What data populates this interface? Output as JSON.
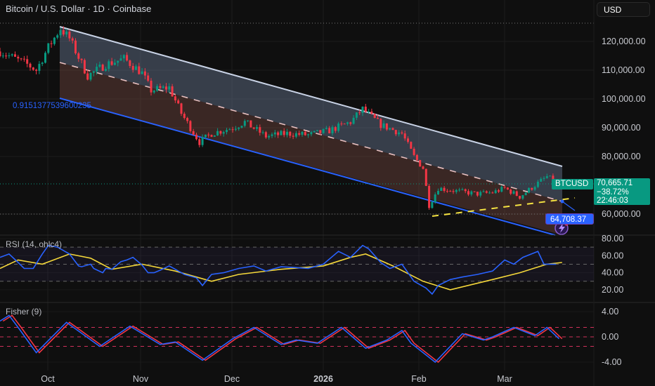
{
  "header": {
    "title": "Bitcoin / U.S. Dollar · 1D · Coinbase",
    "currency_button": "USD"
  },
  "colors": {
    "up": "#089981",
    "down": "#f23645",
    "rsi": "#2962ff",
    "rsi_ma": "#f5d83a",
    "fisher": "#2962ff",
    "fisher_trigger": "#f23645",
    "channel_line": "#c9d3e6",
    "channel_bottom": "#2962ff",
    "median": "#e8c0c0",
    "yellow_line": "#f5e342"
  },
  "price_axis": [
    "120,000.00",
    "110,000.00",
    "100,000.00",
    "90,000.00",
    "80,000.00",
    "60,000.00"
  ],
  "rsi_axis": [
    "80.00",
    "60.00",
    "40.00",
    "20.00"
  ],
  "fisher_axis": [
    "4.00",
    "0.00",
    "-4.00"
  ],
  "time_axis": [
    "Oct",
    "Nov",
    "Dec",
    "2026",
    "Feb",
    "Mar"
  ],
  "symbol_tag": "BTCUSD",
  "last_price": {
    "price": "70,665.71",
    "change": "−38.72%",
    "countdown": "22:46:03"
  },
  "alert_price": "64,708.37",
  "fib_label": "0.9151377539600235",
  "rsi_label": "RSI (14, ohlc4)",
  "fisher_label": "Fisher (9)",
  "chart_data": {
    "type": "candlestick",
    "start_date": "2025-09-15",
    "x_unit": "days since start_date",
    "price_keypoints": [
      [
        0,
        116500
      ],
      [
        9,
        112000
      ],
      [
        12,
        110000
      ],
      [
        16,
        118000
      ],
      [
        20,
        124500
      ],
      [
        23,
        121000
      ],
      [
        29,
        108000
      ],
      [
        35,
        112000
      ],
      [
        41,
        114000
      ],
      [
        47,
        109000
      ],
      [
        50,
        103000
      ],
      [
        56,
        104000
      ],
      [
        60,
        95000
      ],
      [
        66,
        85000
      ],
      [
        70,
        88000
      ],
      [
        77,
        90000
      ],
      [
        81,
        92000
      ],
      [
        88,
        87000
      ],
      [
        95,
        88000
      ],
      [
        102,
        87500
      ],
      [
        109,
        89000
      ],
      [
        116,
        92000
      ],
      [
        120,
        96500
      ],
      [
        126,
        91000
      ],
      [
        133,
        88000
      ],
      [
        137,
        80000
      ],
      [
        140,
        76000
      ],
      [
        142,
        63000
      ],
      [
        145,
        69000
      ],
      [
        151,
        68000
      ],
      [
        158,
        67000
      ],
      [
        163,
        67500
      ],
      [
        167,
        69000
      ],
      [
        172,
        66000
      ],
      [
        177,
        70000
      ],
      [
        181,
        73000
      ],
      [
        184,
        71000
      ],
      [
        185,
        70665
      ]
    ],
    "y_range": [
      56000,
      127000
    ],
    "rsi": {
      "values": [
        [
          0,
          58
        ],
        [
          3,
          62
        ],
        [
          6,
          52
        ],
        [
          8,
          45
        ],
        [
          11,
          45
        ],
        [
          14,
          62
        ],
        [
          16,
          72
        ],
        [
          19,
          70
        ],
        [
          23,
          62
        ],
        [
          26,
          48
        ],
        [
          27,
          47
        ],
        [
          30,
          50
        ],
        [
          31,
          45
        ],
        [
          34,
          40
        ],
        [
          35,
          45
        ],
        [
          37,
          44
        ],
        [
          40,
          53
        ],
        [
          42,
          55
        ],
        [
          44,
          58
        ],
        [
          47,
          49
        ],
        [
          49,
          40
        ],
        [
          51,
          40
        ],
        [
          53,
          43
        ],
        [
          56,
          48
        ],
        [
          58,
          44
        ],
        [
          61,
          38
        ],
        [
          65,
          34
        ],
        [
          67,
          25
        ],
        [
          70,
          38
        ],
        [
          74,
          40
        ],
        [
          79,
          45
        ],
        [
          84,
          48
        ],
        [
          88,
          42
        ],
        [
          93,
          47
        ],
        [
          98,
          46
        ],
        [
          102,
          45
        ],
        [
          107,
          50
        ],
        [
          112,
          65
        ],
        [
          116,
          58
        ],
        [
          120,
          72
        ],
        [
          122,
          68
        ],
        [
          126,
          52
        ],
        [
          129,
          45
        ],
        [
          133,
          50
        ],
        [
          137,
          30
        ],
        [
          141,
          22
        ],
        [
          143,
          15
        ],
        [
          145,
          25
        ],
        [
          149,
          32
        ],
        [
          153,
          35
        ],
        [
          158,
          38
        ],
        [
          163,
          42
        ],
        [
          167,
          55
        ],
        [
          170,
          50
        ],
        [
          173,
          58
        ],
        [
          178,
          65
        ],
        [
          180,
          50
        ],
        [
          184,
          50
        ]
      ],
      "ma": [
        [
          0,
          45
        ],
        [
          6,
          55
        ],
        [
          14,
          50
        ],
        [
          23,
          62
        ],
        [
          30,
          57
        ],
        [
          37,
          44
        ],
        [
          47,
          50
        ],
        [
          58,
          42
        ],
        [
          70,
          30
        ],
        [
          79,
          38
        ],
        [
          93,
          44
        ],
        [
          107,
          48
        ],
        [
          116,
          58
        ],
        [
          121,
          62
        ],
        [
          130,
          48
        ],
        [
          140,
          30
        ],
        [
          149,
          20
        ],
        [
          163,
          32
        ],
        [
          172,
          40
        ],
        [
          181,
          50
        ],
        [
          186,
          52
        ]
      ],
      "levels": [
        70,
        50,
        30
      ],
      "ylim": [
        12,
        86
      ]
    },
    "fisher": {
      "values": [
        [
          0,
          2.5
        ],
        [
          3,
          3.4
        ],
        [
          6,
          1.5
        ],
        [
          12,
          -2.5
        ],
        [
          22,
          2.3
        ],
        [
          33,
          -1.5
        ],
        [
          43,
          1.7
        ],
        [
          53,
          -1.2
        ],
        [
          58,
          -0.8
        ],
        [
          67,
          -3.7
        ],
        [
          77,
          -0.3
        ],
        [
          84,
          1.5
        ],
        [
          93,
          -1.2
        ],
        [
          98,
          -0.5
        ],
        [
          105,
          -1.0
        ],
        [
          113,
          1.5
        ],
        [
          121,
          -1.8
        ],
        [
          128,
          -0.5
        ],
        [
          133,
          1.0
        ],
        [
          136,
          -1.0
        ],
        [
          144,
          -4.0
        ],
        [
          153,
          0.5
        ],
        [
          160,
          -0.5
        ],
        [
          163,
          0.0
        ],
        [
          170,
          1.5
        ],
        [
          177,
          0.2
        ],
        [
          181,
          1.5
        ],
        [
          185,
          -0.3
        ]
      ],
      "levels": [
        1.5,
        0,
        -1.5
      ],
      "ylim": [
        -5,
        5
      ]
    }
  }
}
